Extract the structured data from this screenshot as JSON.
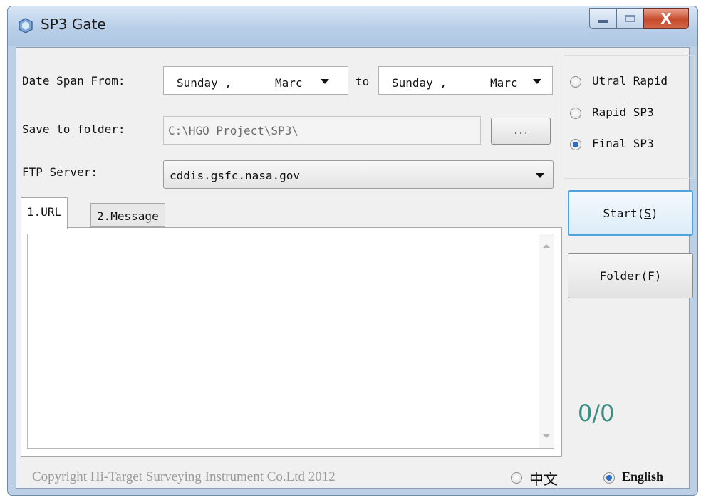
{
  "window": {
    "title": "SP3 Gate",
    "close_label": "X"
  },
  "form": {
    "date_label": "Date Span From:",
    "from_day": "Sunday ,",
    "from_month": "Marc",
    "to_label": "to",
    "to_day": "Sunday ,",
    "to_month": "Marc",
    "save_label": "Save to folder:",
    "save_value": "C:\\HGO Project\\SP3\\",
    "browse_label": "...",
    "ftp_label": "FTP Server:",
    "ftp_value": "cddis.gsfc.nasa.gov"
  },
  "product_options": [
    {
      "label": "Utral Rapid",
      "selected": false
    },
    {
      "label": "Rapid SP3",
      "selected": false
    },
    {
      "label": "Final SP3",
      "selected": true
    }
  ],
  "buttons": {
    "start_text": "Start(",
    "start_key": "S",
    "folder_text": "Folder(",
    "folder_key": "F",
    "close_paren": ")"
  },
  "tabs": [
    {
      "label": "1.URL",
      "active": true
    },
    {
      "label": "2.Message",
      "active": false
    }
  ],
  "progress_text": "0/0",
  "footer": {
    "copyright": "Copyright Hi-Target Surveying Instrument Co.Ltd 2012",
    "lang_options": [
      {
        "label": "中文",
        "selected": false
      },
      {
        "label": "English",
        "selected": true
      }
    ]
  },
  "colors": {
    "progress": "#3a8f84",
    "radio_selected": "#2a6fc5",
    "copyright": "#9a9a9a"
  }
}
